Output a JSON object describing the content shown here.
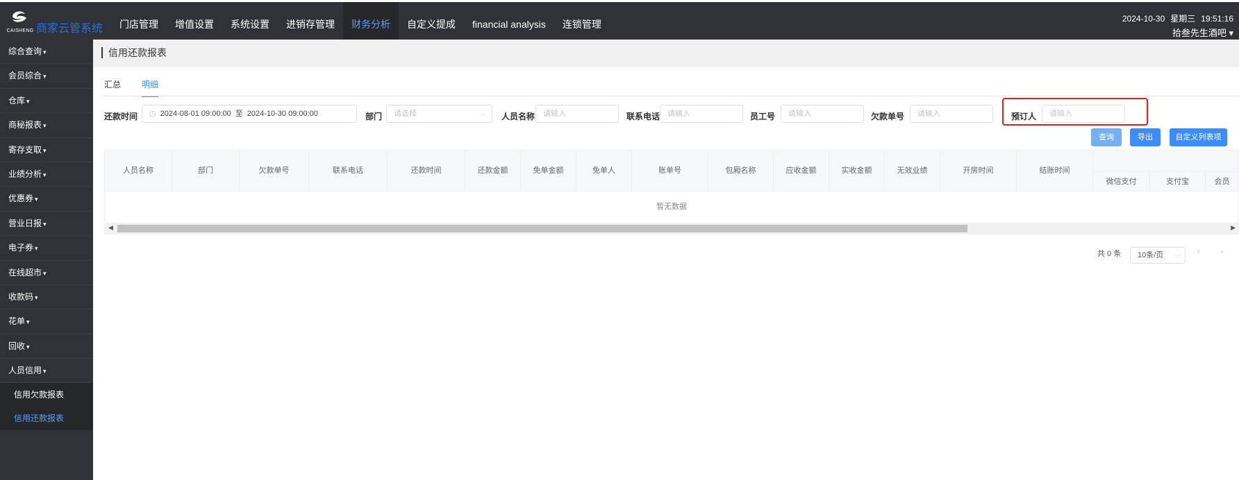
{
  "brand": {
    "logo_text": "CAISHENG",
    "name": "商家云管系统"
  },
  "nav": [
    "门店管理",
    "增值设置",
    "系统设置",
    "进销存管理",
    "财务分析",
    "自定义提成",
    "financial analysis",
    "连锁管理"
  ],
  "header": {
    "date": "2024-10-30",
    "weekday": "星期三",
    "time": "19:51:16",
    "store": "拾叁先生酒吧 ▾"
  },
  "sidebar": {
    "items": [
      "综合查询",
      "会员综合",
      "仓库",
      "商秘报表",
      "寄存支取",
      "业绩分析",
      "优惠券",
      "营业日报",
      "电子券",
      "在线超市",
      "收款码",
      "花单",
      "回收",
      "人员信用"
    ],
    "sub_items": [
      "信用欠款报表",
      "信用还款报表"
    ]
  },
  "page": {
    "title": "信用还款报表"
  },
  "tabs": [
    "汇总",
    "明细"
  ],
  "filters": {
    "date_label": "还款时间",
    "date_from": "2024-08-01 09:00:00",
    "date_sep": "至",
    "date_to": "2024-10-30 09:00:00",
    "dept_label": "部门",
    "dept_placeholder": "请选择",
    "staff_label": "人员名称",
    "staff_placeholder": "请输入",
    "phone_label": "联系电话",
    "phone_placeholder": "请输入",
    "empno_label": "员工号",
    "empno_placeholder": "请输入",
    "debt_label": "欠款单号",
    "debt_placeholder": "请输入",
    "booker_label": "预订人",
    "booker_placeholder": "请输入"
  },
  "buttons": {
    "query": "查询",
    "export": "导出",
    "custom_columns": "自定义列表项"
  },
  "table": {
    "columns": [
      "人员名称",
      "部门",
      "欠款单号",
      "联系电话",
      "还款时间",
      "还款金额",
      "免单金额",
      "免单人",
      "账单号",
      "包厢名称",
      "应收金额",
      "实收金额",
      "无效业绩",
      "开房时间",
      "结账时间"
    ],
    "sub_columns": [
      "微信支付",
      "支付宝",
      "会员"
    ],
    "empty_text": "暂无数据"
  },
  "pagination": {
    "total": "共 0 条",
    "page_size": "10条/页"
  },
  "colors": {
    "topbar": "#2f3237",
    "accent": "#3b8cff",
    "highlight": "#e02020"
  }
}
